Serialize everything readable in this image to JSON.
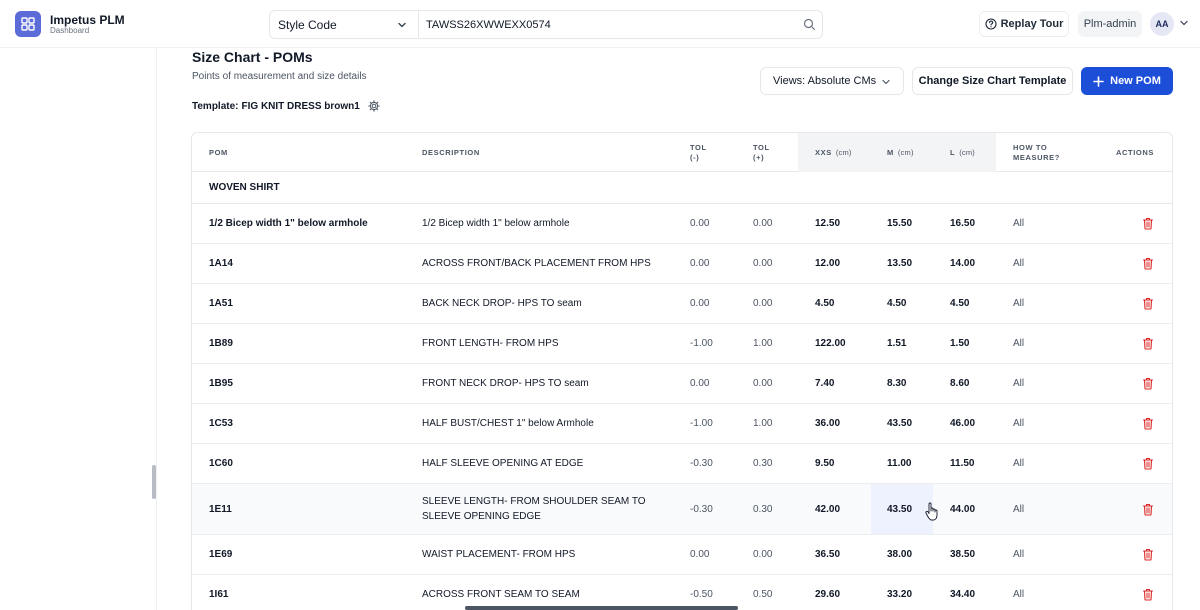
{
  "app": {
    "title": "Impetus PLM",
    "subtitle": "Dashboard"
  },
  "search": {
    "field": "Style Code",
    "value": "TAWSS26XWWEXX0574"
  },
  "header": {
    "replay_label": "Replay Tour",
    "user_label": "Plm-admin",
    "avatar_initials": "AA"
  },
  "section": {
    "title": "Size Chart - POMs",
    "subtitle": "Points of measurement and size details",
    "template_label": "Template:",
    "template_value": "FIG KNIT DRESS brown1"
  },
  "toolbar": {
    "views_label": "Views: Absolute CMs",
    "change_label": "Change Size Chart Template",
    "new_label": "New POM"
  },
  "table": {
    "headers": {
      "pom": "POM",
      "description": "DESCRIPTION",
      "tol_minus_1": "TOL",
      "tol_minus_2": "(-)",
      "tol_plus_1": "TOL",
      "tol_plus_2": "(+)",
      "xxs": "XXS",
      "m": "M",
      "l": "L",
      "unit": "(cm)",
      "how_1": "HOW TO",
      "how_2": "MEASURE?",
      "actions": "ACTIONS"
    },
    "group": "WOVEN SHIRT",
    "rows": [
      {
        "pom": "1/2 Bicep width 1\" below armhole",
        "description": "1/2 Bicep width 1\" below armhole",
        "tol_minus": "0.00",
        "tol_plus": "0.00",
        "xxs": "12.50",
        "m": "15.50",
        "l": "16.50",
        "how": "All"
      },
      {
        "pom": "1A14",
        "description": "ACROSS FRONT/BACK PLACEMENT FROM HPS",
        "tol_minus": "0.00",
        "tol_plus": "0.00",
        "xxs": "12.00",
        "m": "13.50",
        "l": "14.00",
        "how": "All"
      },
      {
        "pom": "1A51",
        "description": "BACK NECK DROP- HPS TO seam",
        "tol_minus": "0.00",
        "tol_plus": "0.00",
        "xxs": "4.50",
        "m": "4.50",
        "l": "4.50",
        "how": "All"
      },
      {
        "pom": "1B89",
        "description": "FRONT LENGTH- FROM HPS",
        "tol_minus": "-1.00",
        "tol_plus": "1.00",
        "xxs": "122.00",
        "m": "1.51",
        "l": "1.50",
        "how": "All"
      },
      {
        "pom": "1B95",
        "description": "FRONT NECK DROP- HPS TO seam",
        "tol_minus": "0.00",
        "tol_plus": "0.00",
        "xxs": "7.40",
        "m": "8.30",
        "l": "8.60",
        "how": "All"
      },
      {
        "pom": "1C53",
        "description": "HALF BUST/CHEST 1\" below Armhole",
        "tol_minus": "-1.00",
        "tol_plus": "1.00",
        "xxs": "36.00",
        "m": "43.50",
        "l": "46.00",
        "how": "All"
      },
      {
        "pom": "1C60",
        "description": "HALF SLEEVE OPENING AT EDGE",
        "tol_minus": "-0.30",
        "tol_plus": "0.30",
        "xxs": "9.50",
        "m": "11.00",
        "l": "11.50",
        "how": "All"
      },
      {
        "pom": "1E11",
        "description": "SLEEVE LENGTH- FROM SHOULDER SEAM TO SLEEVE OPENING EDGE",
        "tol_minus": "-0.30",
        "tol_plus": "0.30",
        "xxs": "42.00",
        "m": "43.50",
        "l": "44.00",
        "how": "All"
      },
      {
        "pom": "1E69",
        "description": "WAIST PLACEMENT- FROM HPS",
        "tol_minus": "0.00",
        "tol_plus": "0.00",
        "xxs": "36.50",
        "m": "38.00",
        "l": "38.50",
        "how": "All"
      },
      {
        "pom": "1I61",
        "description": "ACROSS FRONT SEAM TO SEAM",
        "tol_minus": "-0.50",
        "tol_plus": "0.50",
        "xxs": "29.60",
        "m": "33.20",
        "l": "34.40",
        "how": "All"
      }
    ]
  },
  "colors": {
    "primary": "#1d4ed8",
    "logo": "#5b6bd8",
    "delete": "#dc2626",
    "highlight": "#eef2ff"
  }
}
